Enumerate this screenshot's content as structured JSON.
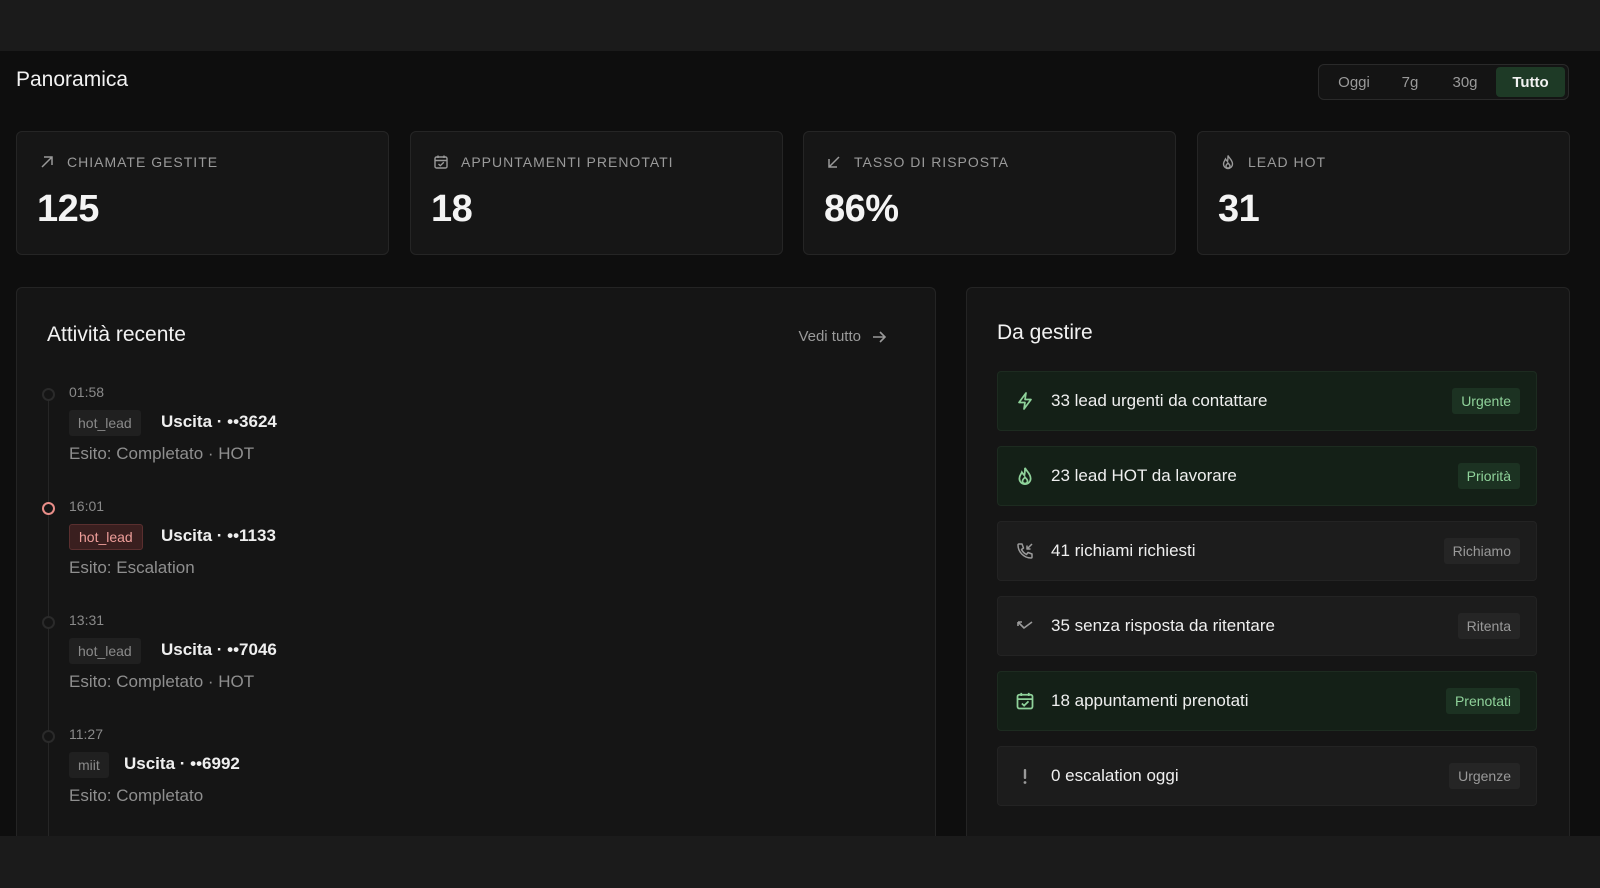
{
  "header": {
    "title": "Panoramica"
  },
  "range": {
    "options": [
      "Oggi",
      "7g",
      "30g",
      "Tutto"
    ],
    "active": "Tutto"
  },
  "stats": [
    {
      "label": "CHIAMATE GESTITE",
      "value": "125",
      "icon": "arrow-up-right-icon"
    },
    {
      "label": "APPUNTAMENTI PRENOTATI",
      "value": "18",
      "icon": "calendar-check-icon"
    },
    {
      "label": "TASSO DI RISPOSTA",
      "value": "86%",
      "icon": "arrow-down-left-icon"
    },
    {
      "label": "LEAD HOT",
      "value": "31",
      "icon": "flame-icon"
    }
  ],
  "activity": {
    "title": "Attività recente",
    "see_all": "Vedi tutto",
    "items": [
      {
        "time": "01:58",
        "tag": "hot_lead",
        "title": "Uscita · ••3624",
        "outcome": "Esito: Completato · HOT",
        "highlight": false
      },
      {
        "time": "16:01",
        "tag": "hot_lead",
        "title": "Uscita · ••1133",
        "outcome": "Esito: Escalation",
        "highlight": true
      },
      {
        "time": "13:31",
        "tag": "hot_lead",
        "title": "Uscita · ••7046",
        "outcome": "Esito: Completato · HOT",
        "highlight": false
      },
      {
        "time": "11:27",
        "tag": "miit",
        "title": "Uscita · ••6992",
        "outcome": "Esito: Completato",
        "highlight": false
      }
    ]
  },
  "todo": {
    "title": "Da gestire",
    "items": [
      {
        "label": "33 lead urgenti da contattare",
        "badge": "Urgente",
        "icon": "lightning-icon",
        "tone": "green"
      },
      {
        "label": "23 lead HOT da lavorare",
        "badge": "Priorità",
        "icon": "flame-icon",
        "tone": "green"
      },
      {
        "label": "41 richiami richiesti",
        "badge": "Richiamo",
        "icon": "phone-callback-icon",
        "tone": "neutral"
      },
      {
        "label": "35 senza risposta da ritentare",
        "badge": "Ritenta",
        "icon": "missed-call-icon",
        "tone": "neutral"
      },
      {
        "label": "18 appuntamenti prenotati",
        "badge": "Prenotati",
        "icon": "calendar-check-icon",
        "tone": "green"
      },
      {
        "label": "0 escalation oggi",
        "badge": "Urgenze",
        "icon": "exclamation-icon",
        "tone": "neutral"
      }
    ]
  },
  "colors": {
    "accent_green": "#8fd29a",
    "active_range_bg": "#1e3a26",
    "hot_tag": "#ef9e9a"
  }
}
